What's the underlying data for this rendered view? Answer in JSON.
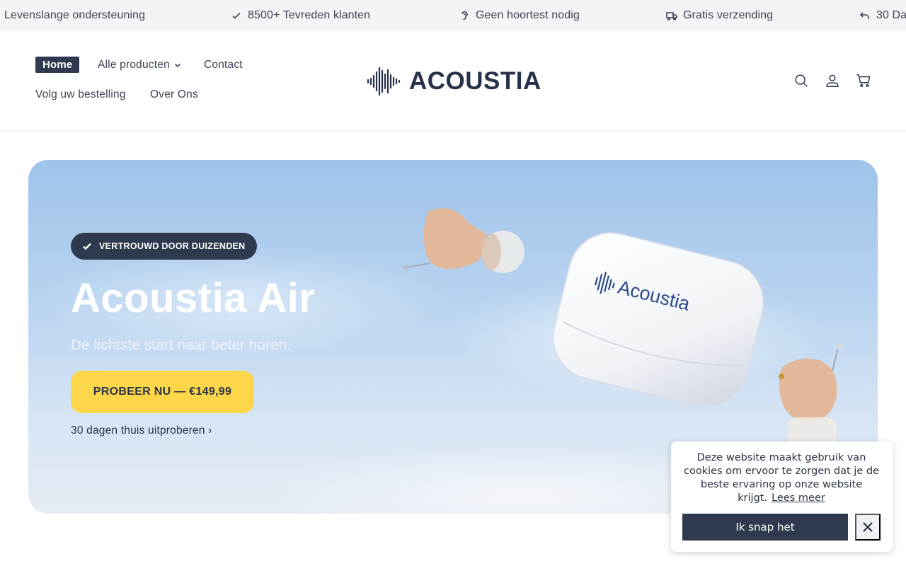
{
  "announcement": {
    "items": [
      {
        "icon": "support-icon",
        "text": "Levenslange ondersteuning"
      },
      {
        "icon": "check-icon",
        "text": "8500+ Tevreden klanten"
      },
      {
        "icon": "ear-icon",
        "text": "Geen hoortest nodig"
      },
      {
        "icon": "truck-icon",
        "text": "Gratis verzending"
      },
      {
        "icon": "return-icon",
        "text": "30 Da"
      }
    ]
  },
  "header": {
    "nav": [
      {
        "label": "Home",
        "active": true
      },
      {
        "label": "Alle producten",
        "has_dropdown": true
      },
      {
        "label": "Contact"
      },
      {
        "label": "Volg uw bestelling"
      },
      {
        "label": "Over Ons"
      }
    ],
    "logo_text": "ACOUSTIA",
    "icons": [
      "search-icon",
      "account-icon",
      "cart-icon"
    ]
  },
  "hero": {
    "badge": "VERTROUWD DOOR DUIZENDEN",
    "title": "Acoustia Air",
    "subtitle": "De lichtste start naar beter horen.",
    "cta_label": "PROBEER NU — €149,99",
    "secondary_link": "30 dagen thuis uitproberen ›",
    "case_brand": "Acoustia"
  },
  "cookie": {
    "message": "Deze website maakt gebruik van cookies om ervoor te zorgen dat je de beste ervaring op onze website krijgt.",
    "link_label": "Lees meer",
    "accept_label": "Ik snap het"
  },
  "colors": {
    "brand_navy": "#2f3a4f",
    "cta_yellow": "#fdd649",
    "announcement_bg": "#f3f4f6"
  }
}
